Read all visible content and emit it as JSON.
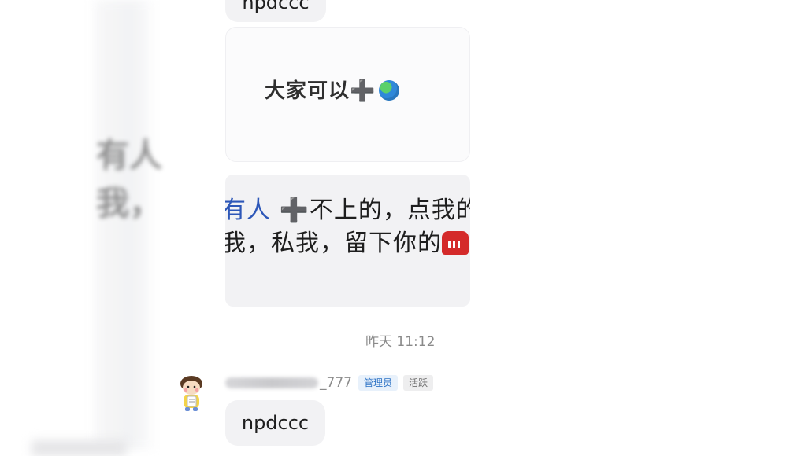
{
  "messages": {
    "top_bubble": "npdccc",
    "image_card_1": {
      "text": "大家可以➕"
    },
    "image_card_2": {
      "line1_blue": "有人",
      "line1_rest": " ➕不上的，点我的",
      "line2": "我，私我，留下你的"
    },
    "timestamp": "昨天 11:12",
    "sender": {
      "name_suffix": "_777",
      "badges": [
        "管理员",
        "活跃"
      ]
    },
    "bottom_bubble": "npdccc"
  },
  "backdrop": {
    "line1": "有人",
    "line2": "我，"
  },
  "colors": {
    "bubble_bg": "#f2f2f4",
    "admin_badge": "#2f74c6",
    "link_blue": "#2d57b8"
  },
  "icons": [
    "globe-icon",
    "telephone-icon",
    "avatar-cartoon"
  ]
}
